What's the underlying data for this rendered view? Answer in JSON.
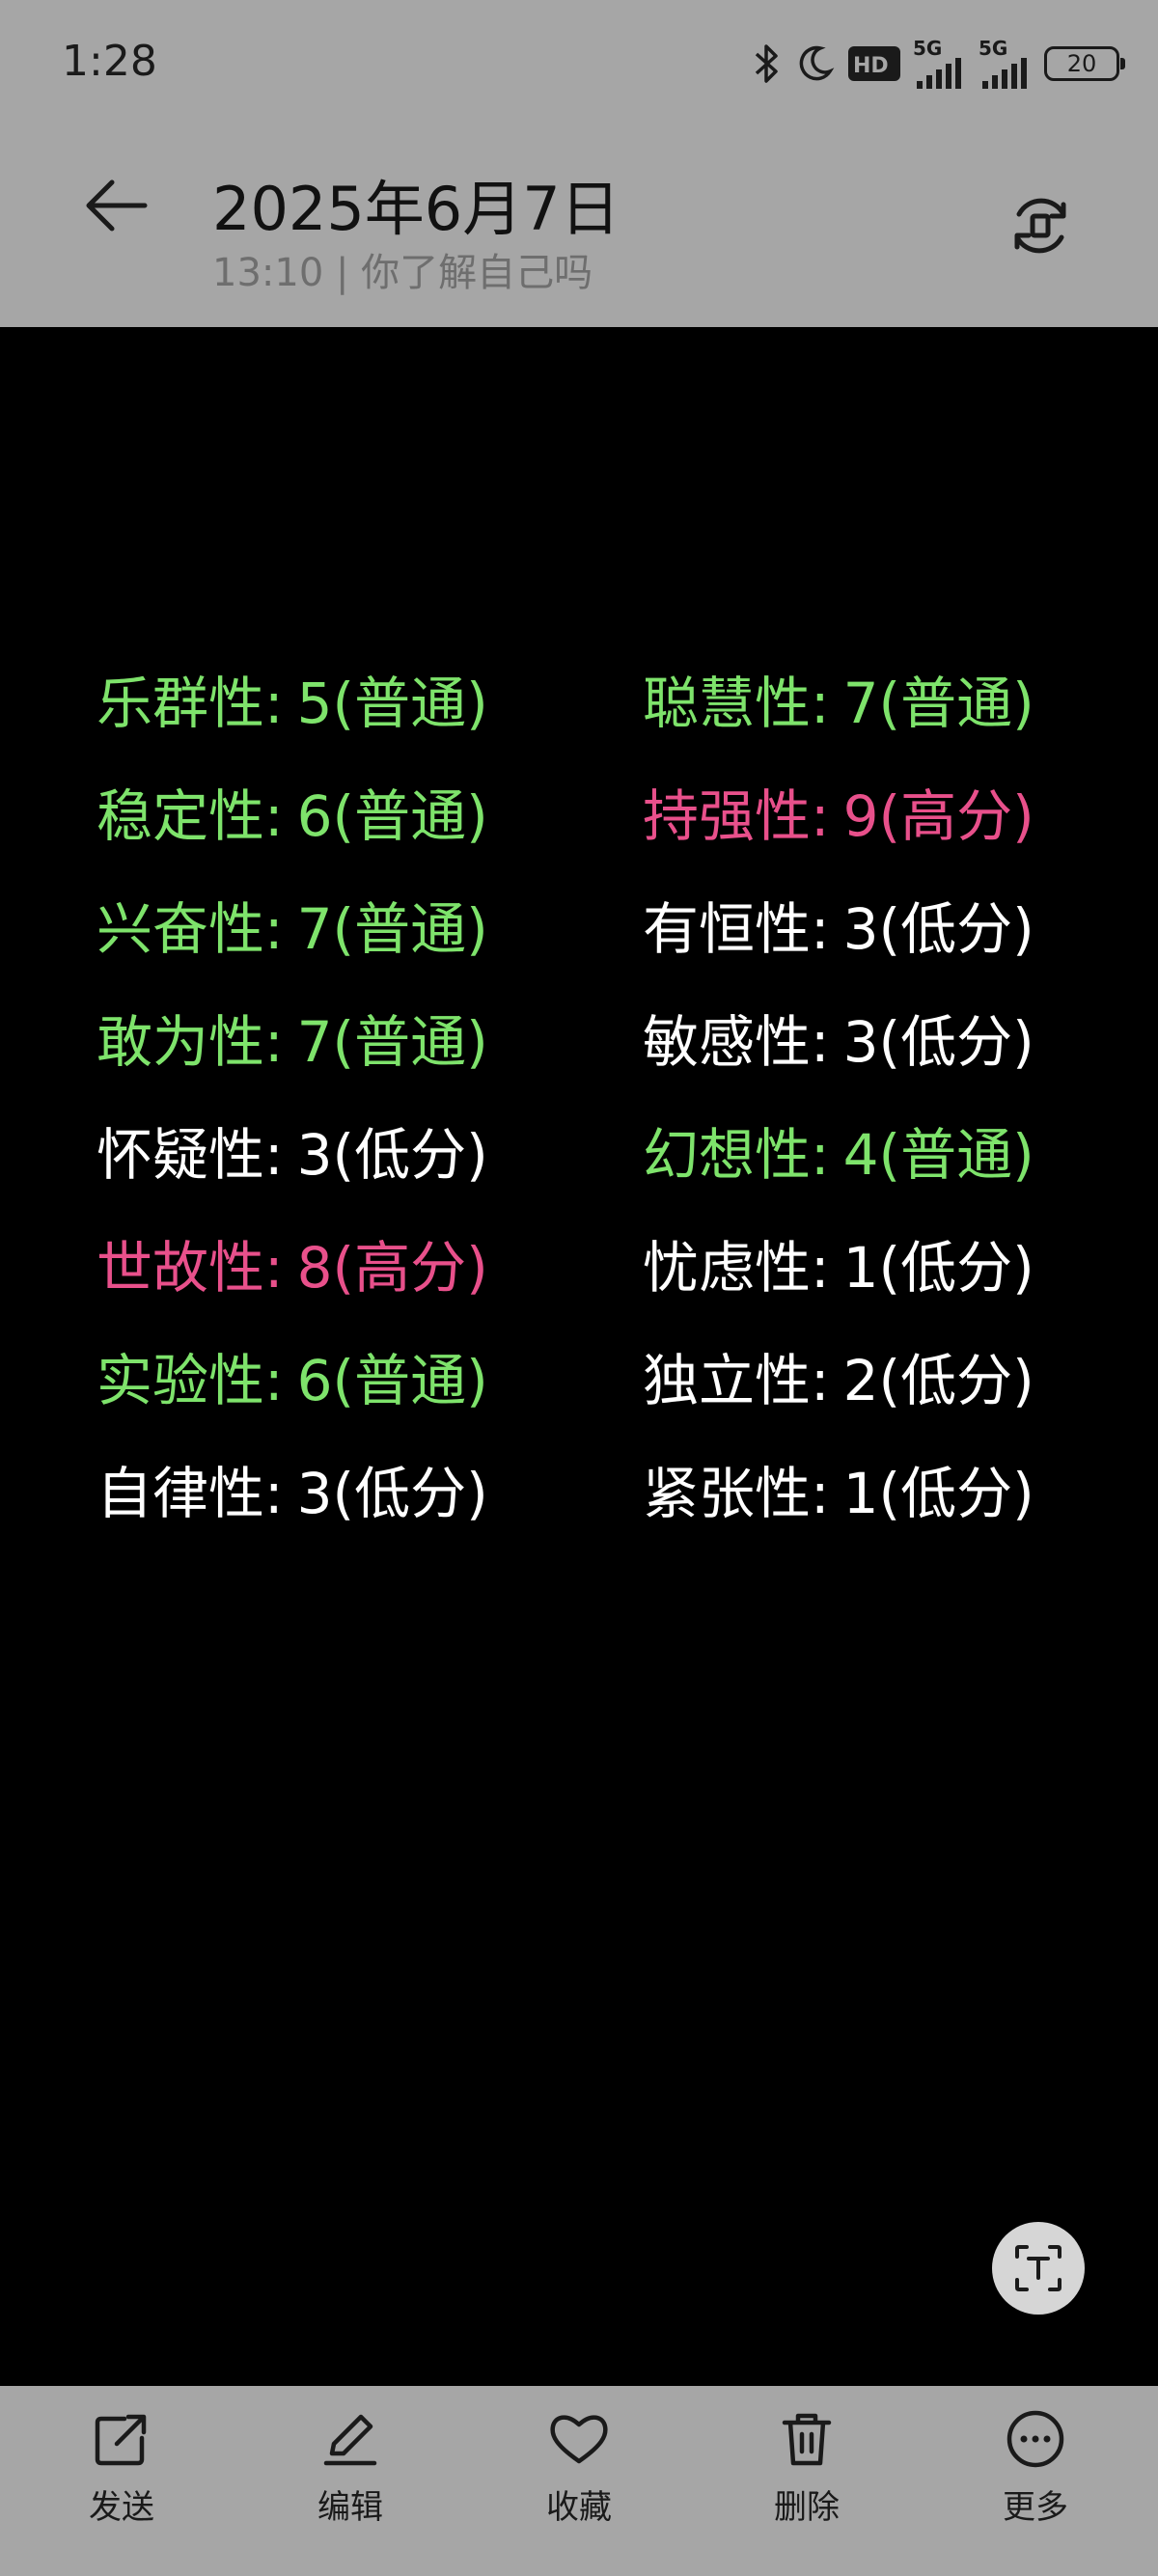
{
  "status_bar": {
    "time": "1:28",
    "icons": [
      "bluetooth-icon",
      "moon-icon",
      "hd-icon",
      "signal-5g-icon",
      "signal-5g-icon"
    ],
    "hd_label": "HD",
    "signal1_label": "5G",
    "signal2_label": "5G",
    "battery": "20"
  },
  "header": {
    "back_icon": "back-arrow-icon",
    "title": "2025年6月7日",
    "subtitle": "13:10 | 你了解自己吗",
    "rotate_icon": "rotate-icon"
  },
  "colors": {
    "normal": "#7ee36b",
    "high": "#e8508b",
    "low": "#ffffff"
  },
  "traits": [
    {
      "label": "乐群性",
      "sep": ":",
      "value": "5(普通)",
      "level": "normal"
    },
    {
      "label": "聪慧性",
      "sep": ":",
      "value": "7(普通)",
      "level": "normal"
    },
    {
      "label": "稳定性",
      "sep": ":",
      "value": "6(普通)",
      "level": "normal"
    },
    {
      "label": "持强性",
      "sep": ":",
      "value": "9(高分)",
      "level": "high"
    },
    {
      "label": "兴奋性",
      "sep": ":",
      "value": "7(普通)",
      "level": "normal"
    },
    {
      "label": "有恒性",
      "sep": ":",
      "value": "3(低分)",
      "level": "low"
    },
    {
      "label": "敢为性",
      "sep": ":",
      "value": "7(普通)",
      "level": "normal"
    },
    {
      "label": "敏感性",
      "sep": ":",
      "value": "3(低分)",
      "level": "low"
    },
    {
      "label": "怀疑性",
      "sep": ":",
      "value": "3(低分)",
      "level": "low"
    },
    {
      "label": "幻想性",
      "sep": ":",
      "value": "4(普通)",
      "level": "normal"
    },
    {
      "label": "世故性",
      "sep": ":",
      "value": "8(高分)",
      "level": "high"
    },
    {
      "label": "忧虑性",
      "sep": ":",
      "value": "1(低分)",
      "level": "low"
    },
    {
      "label": "实验性",
      "sep": ":",
      "value": "6(普通)",
      "level": "normal"
    },
    {
      "label": "独立性",
      "sep": ":",
      "value": "2(低分)",
      "level": "low"
    },
    {
      "label": "自律性",
      "sep": ":",
      "value": "3(低分)",
      "level": "low"
    },
    {
      "label": "紧张性",
      "sep": ":",
      "value": "1(低分)",
      "level": "low"
    }
  ],
  "fab": {
    "icon": "text-scan-icon"
  },
  "bottom_bar": {
    "actions": [
      {
        "label": "发送",
        "icon": "share-icon"
      },
      {
        "label": "编辑",
        "icon": "pencil-icon"
      },
      {
        "label": "收藏",
        "icon": "heart-icon"
      },
      {
        "label": "删除",
        "icon": "trash-icon"
      },
      {
        "label": "更多",
        "icon": "more-icon"
      }
    ]
  }
}
